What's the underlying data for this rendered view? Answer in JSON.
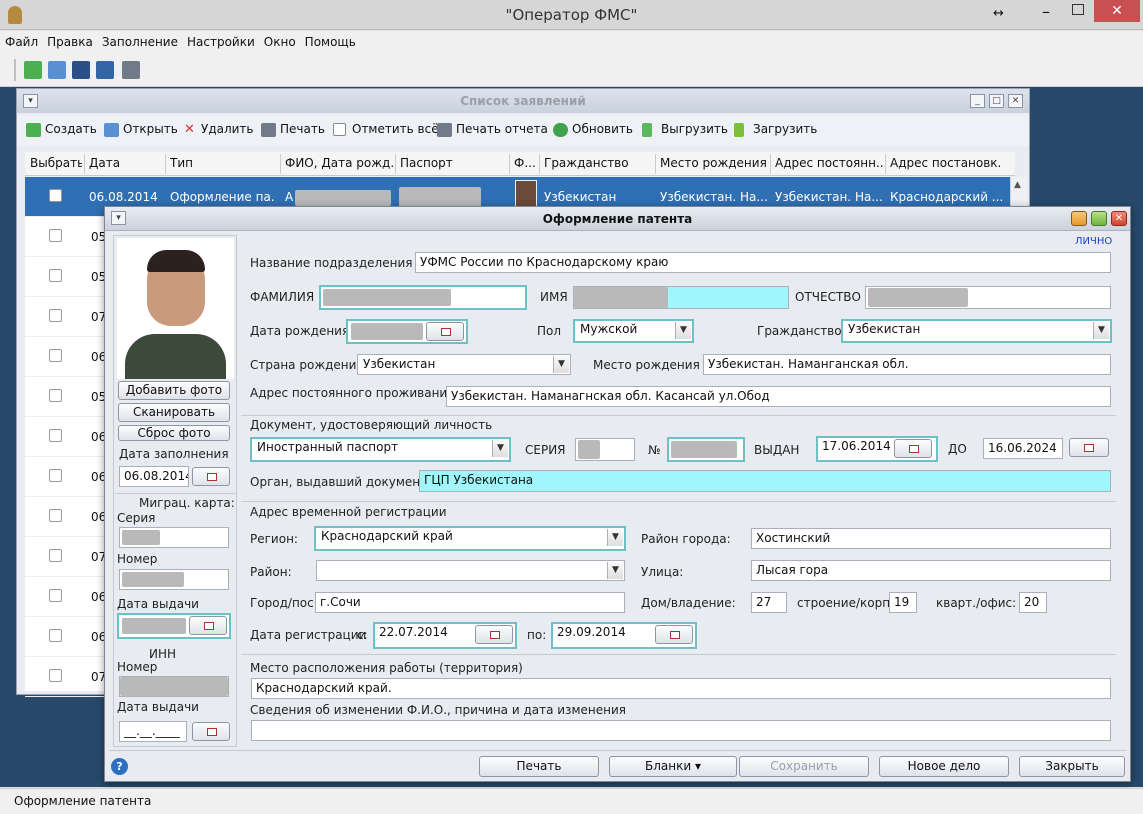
{
  "window": {
    "title": "\"Оператор ФМС\""
  },
  "menu": [
    "Файл",
    "Правка",
    "Заполнение",
    "Настройки",
    "Окно",
    "Помощь"
  ],
  "list_window": {
    "title": "Список заявлений",
    "toolbar": {
      "create": "Создать",
      "open": "Открыть",
      "delete": "Удалить",
      "print": "Печать",
      "mark_all": "Отметить всё",
      "print_report": "Печать отчета",
      "refresh": "Обновить",
      "export": "Выгрузить",
      "import": "Загрузить"
    },
    "columns": [
      "Выбрать",
      "Дата",
      "Тип",
      "ФИО, Дата рожд...",
      "Паспорт",
      "Ф...",
      "Гражданство",
      "Место рождения",
      "Адрес постоянн...",
      "Адрес постановк..."
    ],
    "selected_row": {
      "date": "06.08.2014",
      "type": "Оформление па...",
      "fio_prefix": "А",
      "citizenship": "Узбекистан",
      "birthplace": "Узбекистан. На...",
      "address": "Узбекистан. На...",
      "reg_address": "Краснодарский ..."
    },
    "row_dates": [
      "05",
      "05",
      "07",
      "06",
      "05",
      "06",
      "06",
      "06",
      "07",
      "06",
      "06",
      "07"
    ]
  },
  "dialog": {
    "title": "Оформление патента",
    "lichno": "ЛИЧНО",
    "left": {
      "add_photo": "Добавить фото",
      "scan": "Сканировать",
      "reset_photo": "Сброс фото",
      "fill_date_label": "Дата заполнения",
      "fill_date": "06.08.2014",
      "migr_card": "Миграц. карта:",
      "series": "Серия",
      "number": "Номер",
      "issue_date": "Дата выдачи",
      "inn": "ИНН",
      "inn_number": "Номер",
      "inn_issue_date": "Дата выдачи",
      "inn_date_value": "__.__.____"
    },
    "dept_label": "Название подразделения",
    "dept": "УФМС России по Краснодарскому краю",
    "surname_label": "ФАМИЛИЯ",
    "name_label": "ИМЯ",
    "patronymic_label": "ОТЧЕСТВО",
    "birthdate_label": "Дата рождения",
    "sex_label": "Пол",
    "sex": "Мужской",
    "citizenship_label": "Гражданство",
    "citizenship": "Узбекистан",
    "birth_country_label": "Страна рождения",
    "birth_country": "Узбекистан",
    "birthplace_label": "Место рождения",
    "birthplace": "Узбекистан. Наманганская обл.",
    "perm_address_label": "Адрес постоянного проживания",
    "perm_address": "Узбекистан. Наманагнская обл. Касансай ул.Обод",
    "id_doc_section": "Документ, удостоверяющий личность",
    "doc_type": "Иностранный паспорт",
    "series_label": "СЕРИЯ",
    "no_label": "№",
    "issued_label": "ВЫДАН",
    "issued": "17.06.2014",
    "until_label": "ДО",
    "until": "16.06.2024",
    "issuer_label": "Орган, выдавший документ",
    "issuer": "ГЦП Узбекистана",
    "temp_reg_section": "Адрес временной регистрации",
    "region_label": "Регион:",
    "region": "Краснодарский край",
    "city_district_label": "Район города:",
    "city_district": "Хостинский",
    "district_label": "Район:",
    "district": "",
    "street_label": "Улица:",
    "street": "Лысая гора",
    "city_label": "Город/пос.:",
    "city": "г.Сочи",
    "house_label": "Дом/владение:",
    "house": "27",
    "building_label": "строение/корп.:",
    "building": "19",
    "apt_label": "кварт./офис:",
    "apt": "20",
    "reg_date_label": "Дата регистрации",
    "from_label": "с:",
    "reg_from": "22.07.2014",
    "to_label": "по:",
    "reg_to": "29.09.2014",
    "work_place_label": "Место расположения работы (территория)",
    "work_place": "Краснодарский край.",
    "name_change_label": "Сведения об изменении Ф.И.О., причина и дата изменения",
    "name_change": "",
    "footer": {
      "print": "Печать",
      "blanks": "Бланки ▾",
      "save": "Сохранить",
      "new_case": "Новое дело",
      "close": "Закрыть"
    }
  },
  "status": "Оформление патента",
  "colors": {
    "accent": "#2f6fb3",
    "required_border": "#6ebfc6",
    "highlight": "#9ff6fb",
    "desktop": "#27496a"
  }
}
